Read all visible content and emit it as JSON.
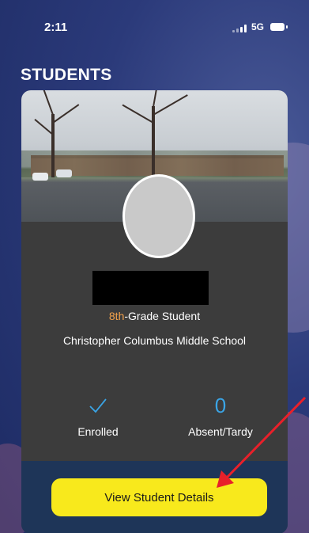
{
  "status_bar": {
    "time": "2:11",
    "network": "5G"
  },
  "page": {
    "title": "STUDENTS"
  },
  "student_card": {
    "grade_number": "8th",
    "grade_suffix": "-Grade Student",
    "school": "Christopher Columbus Middle School",
    "stats": {
      "enrolled": {
        "icon": "check-icon",
        "label": "Enrolled"
      },
      "absent": {
        "value": "0",
        "label": "Absent/Tardy"
      }
    },
    "details_button": "View Student Details"
  },
  "colors": {
    "background": "#2b3a7a",
    "card": "#3c3c3c",
    "footer": "#1e3558",
    "grade_accent": "#f0a04b",
    "stat_accent": "#3aa5e6",
    "button": "#f8e91c",
    "annotation_arrow": "#e8202a"
  }
}
